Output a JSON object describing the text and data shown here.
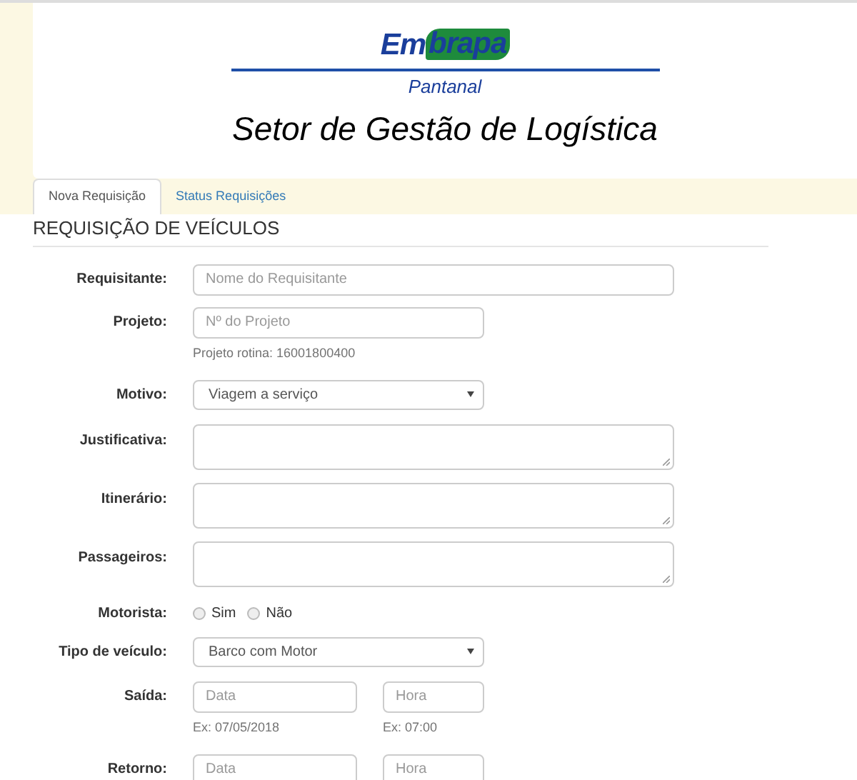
{
  "logo": {
    "parts": [
      "Em",
      "brapa"
    ],
    "subtitle": "Pantanal"
  },
  "page_title": "Setor de Gestão de Logística",
  "tabs": [
    {
      "label": "Nova Requisição",
      "selected": true
    },
    {
      "label": "Status Requisições",
      "selected": false
    }
  ],
  "form": {
    "heading": "REQUISIÇÃO DE VEÍCULOS",
    "rows": [
      {
        "kind": "text",
        "label": "Requisitante:",
        "placeholder": "Nome do Requisitante"
      },
      {
        "kind": "short",
        "label": "Projeto:",
        "placeholder": "Nº do Projeto",
        "help": "Projeto rotina: 16001800400"
      },
      {
        "kind": "select",
        "label": "Motivo:",
        "value": "Viagem a serviço"
      },
      {
        "kind": "textarea",
        "label": "Justificativa:"
      },
      {
        "kind": "textarea",
        "label": "Itinerário:"
      },
      {
        "kind": "textarea",
        "label": "Passageiros:"
      },
      {
        "kind": "radio",
        "label": "Motorista:",
        "options": [
          {
            "label": "Sim",
            "selected": false
          },
          {
            "label": "Não",
            "selected": false
          }
        ]
      },
      {
        "kind": "select",
        "label": "Tipo de veículo:",
        "value": "Barco com Motor"
      },
      {
        "kind": "datetime",
        "label": "Saída:",
        "date_placeholder": "Data",
        "time_placeholder": "Hora",
        "date_help": "Ex: 07/05/2018",
        "time_help": "Ex: 07:00"
      },
      {
        "kind": "datetime",
        "label": "Retorno:",
        "date_placeholder": "Data",
        "time_placeholder": "Hora"
      }
    ]
  }
}
